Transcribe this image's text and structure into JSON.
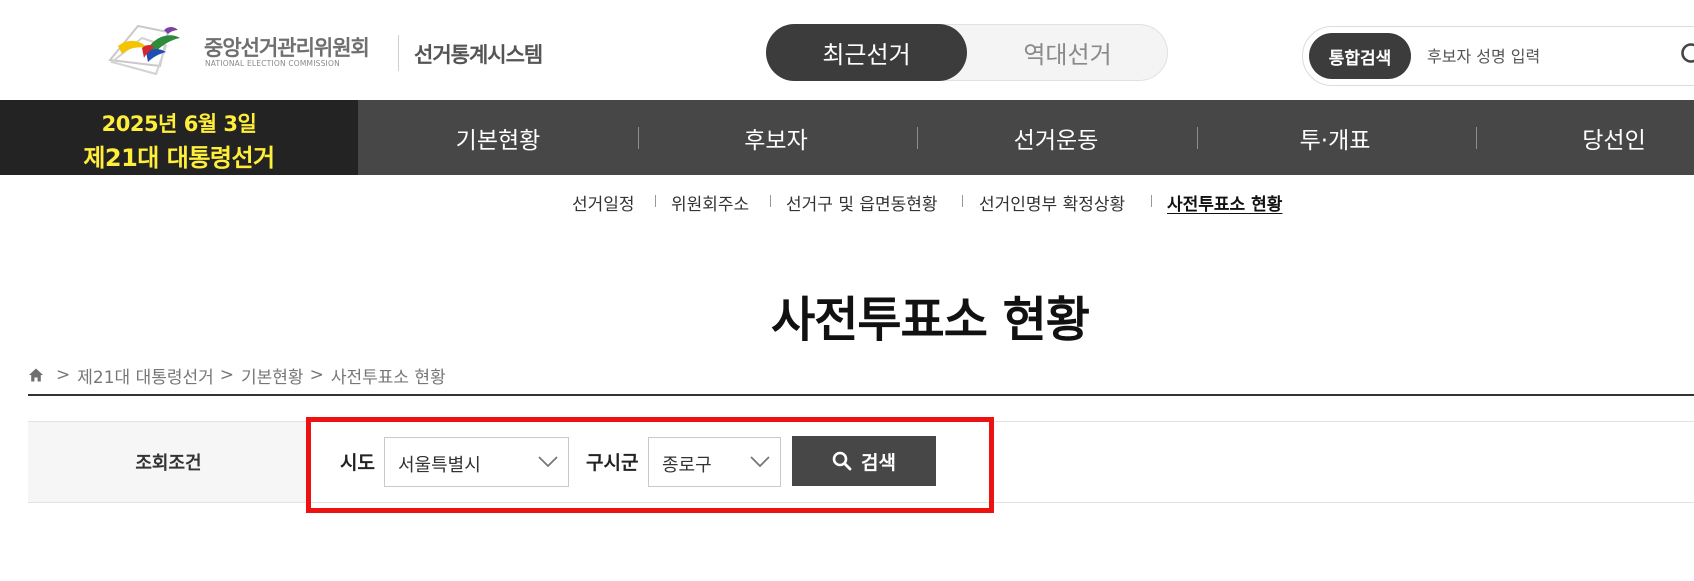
{
  "header": {
    "logo_kr": "중앙선거관리위원회",
    "logo_en": "NATIONAL ELECTION COMMISSION",
    "system_name": "선거통계시스템",
    "toggle": {
      "recent": "최근선거",
      "past": "역대선거"
    },
    "search": {
      "pill_label": "통합검색",
      "placeholder": "후보자 성명 입력"
    }
  },
  "election": {
    "date": "2025년 6월 3일",
    "name": "제21대 대통령선거"
  },
  "gnb": {
    "items": [
      "기본현황",
      "후보자",
      "선거운동",
      "투·개표",
      "당선인"
    ]
  },
  "subnav": {
    "items": [
      "선거일정",
      "위원회주소",
      "선거구 및 읍면동현황",
      "선거인명부 확정상황",
      "사전투표소 현황"
    ],
    "active_index": 4
  },
  "page": {
    "title": "사전투표소 현황",
    "breadcrumb": [
      "제21대 대통령선거",
      "기본현황",
      "사전투표소 현황"
    ]
  },
  "filter": {
    "section_label": "조회조건",
    "sido_label": "시도",
    "sido_value": "서울특별시",
    "gusigun_label": "구시군",
    "gusigun_value": "종로구",
    "search_button": "검색"
  },
  "colors": {
    "gnb_bg": "#474747",
    "date_bg": "#232323",
    "date_text": "#ffee3a",
    "highlight": "#ee1111"
  }
}
